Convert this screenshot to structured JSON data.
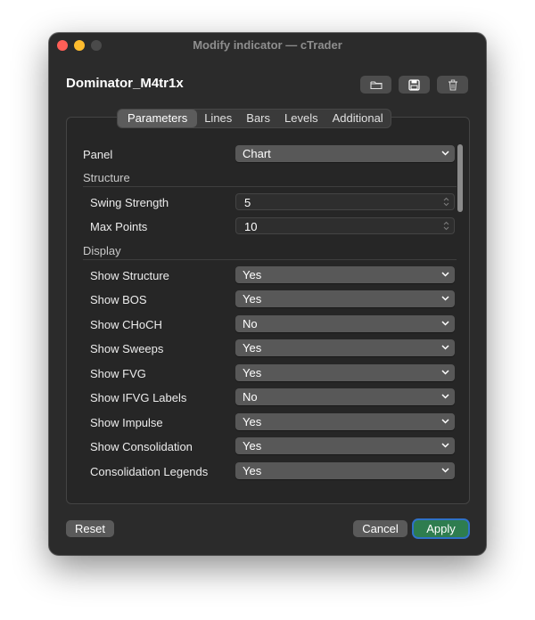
{
  "window": {
    "title": "Modify indicator — cTrader"
  },
  "header": {
    "indicator_name": "Dominator_M4tr1x",
    "buttons": [
      {
        "name": "open-folder-button",
        "icon": "folder-icon"
      },
      {
        "name": "save-button",
        "icon": "save-icon"
      },
      {
        "name": "delete-button",
        "icon": "trash-icon"
      }
    ]
  },
  "tabs": [
    {
      "label": "Parameters",
      "active": true
    },
    {
      "label": "Lines"
    },
    {
      "label": "Bars"
    },
    {
      "label": "Levels"
    },
    {
      "label": "Additional"
    }
  ],
  "parameters": {
    "panel": {
      "label": "Panel",
      "value": "Chart"
    },
    "structure": {
      "title": "Structure",
      "items": [
        {
          "label": "Swing Strength",
          "value": "5"
        },
        {
          "label": "Max Points",
          "value": "10"
        }
      ]
    },
    "display": {
      "title": "Display",
      "items": [
        {
          "label": "Show Structure",
          "value": "Yes"
        },
        {
          "label": "Show BOS",
          "value": "Yes"
        },
        {
          "label": "Show CHoCH",
          "value": "No"
        },
        {
          "label": "Show Sweeps",
          "value": "Yes"
        },
        {
          "label": "Show FVG",
          "value": "Yes"
        },
        {
          "label": "Show IFVG Labels",
          "value": "No"
        },
        {
          "label": "Show Impulse",
          "value": "Yes"
        },
        {
          "label": "Show Consolidation",
          "value": "Yes"
        },
        {
          "label": "Consolidation Legends",
          "value": "Yes"
        }
      ]
    }
  },
  "footer": {
    "reset_label": "Reset",
    "cancel_label": "Cancel",
    "apply_label": "Apply"
  },
  "colors": {
    "window_bg": "#2b2b2b",
    "dropdown_bg": "#585858",
    "apply_bg": "#2e7d4f",
    "focus_ring": "#2f72c8",
    "traffic_red": "#ff5f57",
    "traffic_yellow": "#febc2e"
  }
}
